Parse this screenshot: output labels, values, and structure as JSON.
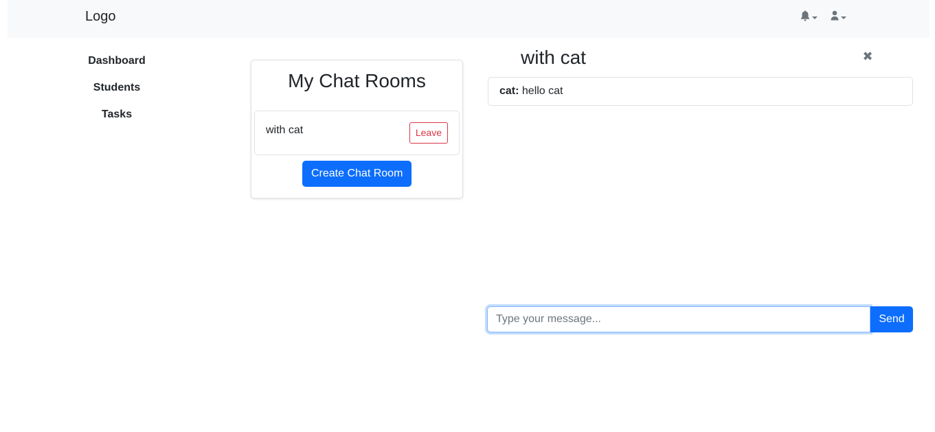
{
  "navbar": {
    "logo": "Logo",
    "icons": [
      "bell-icon",
      "user-icon"
    ]
  },
  "sidebar": {
    "items": [
      {
        "label": "Dashboard"
      },
      {
        "label": "Students"
      },
      {
        "label": "Tasks"
      }
    ]
  },
  "rooms": {
    "title": "My Chat Rooms",
    "list": [
      {
        "name": "with cat",
        "leave_label": "Leave"
      }
    ],
    "create_label": "Create Chat Room"
  },
  "chat": {
    "title": "with cat",
    "close_symbol": "✖",
    "messages": [
      {
        "author": "cat:",
        "text": " hello cat"
      }
    ],
    "input": {
      "value": "",
      "placeholder": "Type your message..."
    },
    "send_label": "Send"
  },
  "colors": {
    "primary": "#0d6efd",
    "danger": "#dc3545",
    "navbar_bg": "#f8f9fa",
    "muted": "#6c757d"
  }
}
